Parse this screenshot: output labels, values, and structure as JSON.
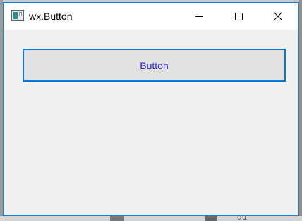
{
  "window": {
    "title": "wx.Button",
    "app_icon": "window-app-icon",
    "controls": {
      "minimize": "minimize-icon",
      "maximize": "maximize-icon",
      "close": "close-icon"
    }
  },
  "main": {
    "button_label": "Button"
  },
  "background": {
    "fragment_text": "ou"
  },
  "colors": {
    "accent": "#0078d7",
    "window_border": "#1883d7",
    "button_text": "#2a20e0",
    "client_bg": "#f0f0f0"
  }
}
